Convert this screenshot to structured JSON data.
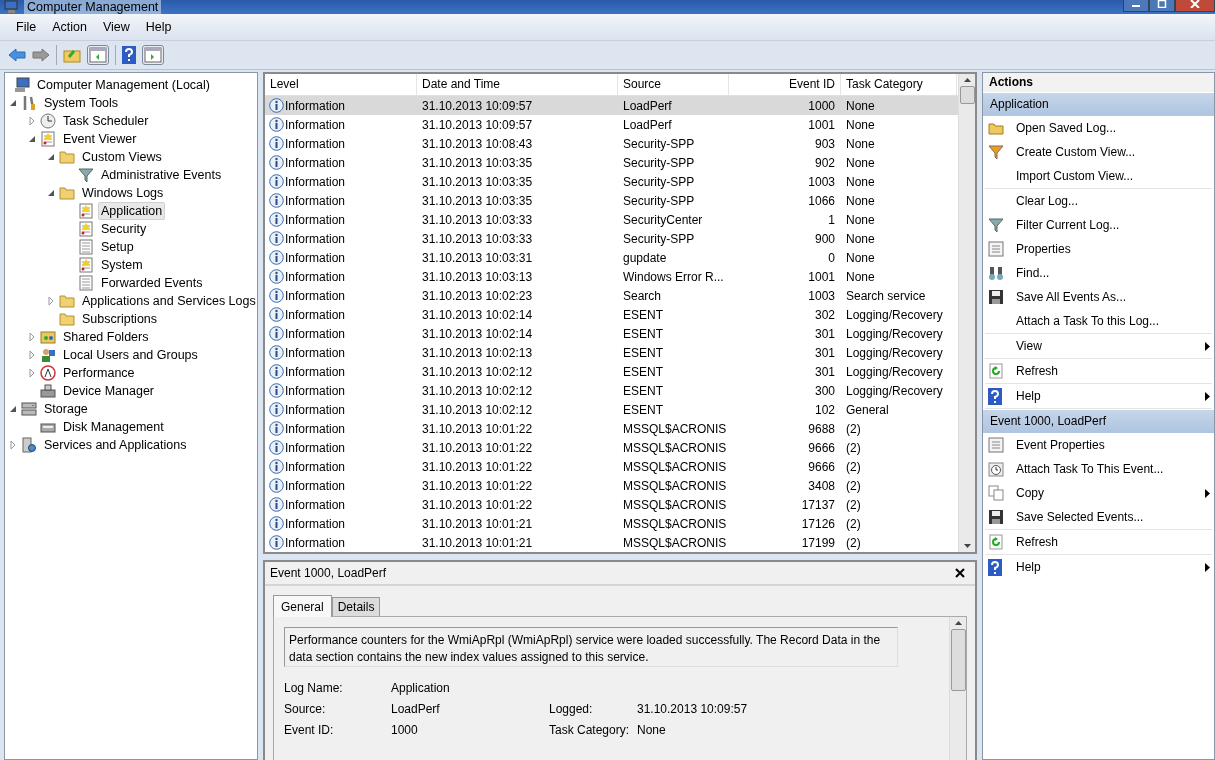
{
  "window": {
    "title": "Computer Management"
  },
  "menu": [
    "File",
    "Action",
    "View",
    "Help"
  ],
  "tree": [
    {
      "label": "Computer Management (Local)",
      "selected": false,
      "children": [
        {
          "label": "System Tools",
          "expanded": true,
          "selected": false,
          "children": [
            {
              "label": "Task Scheduler",
              "expanded": false,
              "selected": false
            },
            {
              "label": "Event Viewer",
              "expanded": true,
              "selected": false,
              "children": [
                {
                  "label": "Custom Views",
                  "expanded": true,
                  "selected": false,
                  "children": [
                    {
                      "label": "Administrative Events",
                      "selected": false
                    }
                  ]
                },
                {
                  "label": "Windows Logs",
                  "expanded": true,
                  "selected": false,
                  "children": [
                    {
                      "label": "Application",
                      "selected": true
                    },
                    {
                      "label": "Security",
                      "selected": false
                    },
                    {
                      "label": "Setup",
                      "selected": false
                    },
                    {
                      "label": "System",
                      "selected": false
                    },
                    {
                      "label": "Forwarded Events",
                      "selected": false
                    }
                  ]
                },
                {
                  "label": "Applications and Services Logs",
                  "expanded": false,
                  "selected": false
                },
                {
                  "label": "Subscriptions",
                  "selected": false
                }
              ]
            },
            {
              "label": "Shared Folders",
              "expanded": false,
              "selected": false
            },
            {
              "label": "Local Users and Groups",
              "expanded": false,
              "selected": false
            },
            {
              "label": "Performance",
              "expanded": false,
              "selected": false
            },
            {
              "label": "Device Manager",
              "selected": false
            }
          ]
        },
        {
          "label": "Storage",
          "expanded": true,
          "selected": false,
          "children": [
            {
              "label": "Disk Management",
              "selected": false
            }
          ]
        },
        {
          "label": "Services and Applications",
          "expanded": false,
          "selected": false
        }
      ]
    }
  ],
  "table": {
    "columns": [
      "Level",
      "Date and Time",
      "Source",
      "Event ID",
      "Task Category"
    ],
    "rows": [
      {
        "level": "Information",
        "date_time": "31.10.2013 10:09:57",
        "source": "LoadPerf",
        "event_id": "1000",
        "task_category": "None",
        "selected": true
      },
      {
        "level": "Information",
        "date_time": "31.10.2013 10:09:57",
        "source": "LoadPerf",
        "event_id": "1001",
        "task_category": "None",
        "selected": false
      },
      {
        "level": "Information",
        "date_time": "31.10.2013 10:08:43",
        "source": "Security-SPP",
        "event_id": "903",
        "task_category": "None",
        "selected": false
      },
      {
        "level": "Information",
        "date_time": "31.10.2013 10:03:35",
        "source": "Security-SPP",
        "event_id": "902",
        "task_category": "None",
        "selected": false
      },
      {
        "level": "Information",
        "date_time": "31.10.2013 10:03:35",
        "source": "Security-SPP",
        "event_id": "1003",
        "task_category": "None",
        "selected": false
      },
      {
        "level": "Information",
        "date_time": "31.10.2013 10:03:35",
        "source": "Security-SPP",
        "event_id": "1066",
        "task_category": "None",
        "selected": false
      },
      {
        "level": "Information",
        "date_time": "31.10.2013 10:03:33",
        "source": "SecurityCenter",
        "event_id": "1",
        "task_category": "None",
        "selected": false
      },
      {
        "level": "Information",
        "date_time": "31.10.2013 10:03:33",
        "source": "Security-SPP",
        "event_id": "900",
        "task_category": "None",
        "selected": false
      },
      {
        "level": "Information",
        "date_time": "31.10.2013 10:03:31",
        "source": "gupdate",
        "event_id": "0",
        "task_category": "None",
        "selected": false
      },
      {
        "level": "Information",
        "date_time": "31.10.2013 10:03:13",
        "source": "Windows Error R...",
        "event_id": "1001",
        "task_category": "None",
        "selected": false
      },
      {
        "level": "Information",
        "date_time": "31.10.2013 10:02:23",
        "source": "Search",
        "event_id": "1003",
        "task_category": "Search service",
        "selected": false
      },
      {
        "level": "Information",
        "date_time": "31.10.2013 10:02:14",
        "source": "ESENT",
        "event_id": "302",
        "task_category": "Logging/Recovery",
        "selected": false
      },
      {
        "level": "Information",
        "date_time": "31.10.2013 10:02:14",
        "source": "ESENT",
        "event_id": "301",
        "task_category": "Logging/Recovery",
        "selected": false
      },
      {
        "level": "Information",
        "date_time": "31.10.2013 10:02:13",
        "source": "ESENT",
        "event_id": "301",
        "task_category": "Logging/Recovery",
        "selected": false
      },
      {
        "level": "Information",
        "date_time": "31.10.2013 10:02:12",
        "source": "ESENT",
        "event_id": "301",
        "task_category": "Logging/Recovery",
        "selected": false
      },
      {
        "level": "Information",
        "date_time": "31.10.2013 10:02:12",
        "source": "ESENT",
        "event_id": "300",
        "task_category": "Logging/Recovery",
        "selected": false
      },
      {
        "level": "Information",
        "date_time": "31.10.2013 10:02:12",
        "source": "ESENT",
        "event_id": "102",
        "task_category": "General",
        "selected": false
      },
      {
        "level": "Information",
        "date_time": "31.10.2013 10:01:22",
        "source": "MSSQL$ACRONIS",
        "event_id": "9688",
        "task_category": "(2)",
        "selected": false
      },
      {
        "level": "Information",
        "date_time": "31.10.2013 10:01:22",
        "source": "MSSQL$ACRONIS",
        "event_id": "9666",
        "task_category": "(2)",
        "selected": false
      },
      {
        "level": "Information",
        "date_time": "31.10.2013 10:01:22",
        "source": "MSSQL$ACRONIS",
        "event_id": "9666",
        "task_category": "(2)",
        "selected": false
      },
      {
        "level": "Information",
        "date_time": "31.10.2013 10:01:22",
        "source": "MSSQL$ACRONIS",
        "event_id": "3408",
        "task_category": "(2)",
        "selected": false
      },
      {
        "level": "Information",
        "date_time": "31.10.2013 10:01:22",
        "source": "MSSQL$ACRONIS",
        "event_id": "17137",
        "task_category": "(2)",
        "selected": false
      },
      {
        "level": "Information",
        "date_time": "31.10.2013 10:01:21",
        "source": "MSSQL$ACRONIS",
        "event_id": "17126",
        "task_category": "(2)",
        "selected": false
      },
      {
        "level": "Information",
        "date_time": "31.10.2013 10:01:21",
        "source": "MSSQL$ACRONIS",
        "event_id": "17199",
        "task_category": "(2)",
        "selected": false
      }
    ]
  },
  "detail": {
    "title": "Event 1000, LoadPerf",
    "tabs": [
      {
        "label": "General",
        "selected": true
      },
      {
        "label": "Details",
        "selected": false
      }
    ],
    "message": "Performance counters for the WmiApRpl (WmiApRpl) service were loaded successfully. The Record Data in the data section contains the new index values assigned to this service.",
    "fields": [
      [
        {
          "label": "Log Name:",
          "value": "Application"
        }
      ],
      [
        {
          "label": "Source:",
          "value": "LoadPerf"
        },
        {
          "label": "Logged:",
          "value": "31.10.2013 10:09:57"
        }
      ],
      [
        {
          "label": "Event ID:",
          "value": "1000"
        },
        {
          "label": "Task Category:",
          "value": "None"
        }
      ]
    ]
  },
  "actions": {
    "title": "Actions",
    "sections": [
      {
        "title": "Application",
        "groups": [
          [
            {
              "label": "Open Saved Log...",
              "submenu": false
            },
            {
              "label": "Create Custom View...",
              "submenu": false
            },
            {
              "label": "Import Custom View...",
              "submenu": false
            }
          ],
          [
            {
              "label": "Clear Log...",
              "submenu": false
            },
            {
              "label": "Filter Current Log...",
              "submenu": false
            },
            {
              "label": "Properties",
              "submenu": false
            },
            {
              "label": "Find...",
              "submenu": false
            },
            {
              "label": "Save All Events As...",
              "submenu": false
            },
            {
              "label": "Attach a Task To this Log...",
              "submenu": false
            }
          ],
          [
            {
              "label": "View",
              "submenu": true
            }
          ],
          [
            {
              "label": "Refresh",
              "submenu": false
            }
          ],
          [
            {
              "label": "Help",
              "submenu": true
            }
          ]
        ]
      },
      {
        "title": "Event 1000, LoadPerf",
        "groups": [
          [
            {
              "label": "Event Properties",
              "submenu": false
            },
            {
              "label": "Attach Task To This Event...",
              "submenu": false
            },
            {
              "label": "Copy",
              "submenu": true
            },
            {
              "label": "Save Selected Events...",
              "submenu": false
            }
          ],
          [
            {
              "label": "Refresh",
              "submenu": false
            }
          ],
          [
            {
              "label": "Help",
              "submenu": true
            }
          ]
        ]
      }
    ]
  }
}
